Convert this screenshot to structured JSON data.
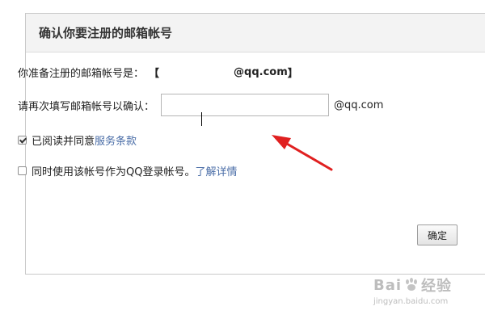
{
  "dialog": {
    "title": "确认你要注册的邮箱帐号",
    "email_label": "你准备注册的邮箱帐号是：",
    "email_open": "【",
    "email_domain": "@qq.com",
    "email_close": "】",
    "confirm_label": "请再次填写邮箱帐号以确认：",
    "confirm_value": "",
    "confirm_suffix": "@qq.com",
    "agree_checked": true,
    "agree_text": "已阅读并同意",
    "agree_link": "服务条款",
    "qq_checked": false,
    "qq_text": "同时使用该帐号作为QQ登录帐号。",
    "qq_link": "了解详情",
    "ok_label": "确定"
  },
  "annotation": {
    "arrow_color": "#e02020"
  },
  "watermark": {
    "brand_left": "Bai",
    "brand_right": "经验",
    "url": "jingyan.baidu.com"
  }
}
